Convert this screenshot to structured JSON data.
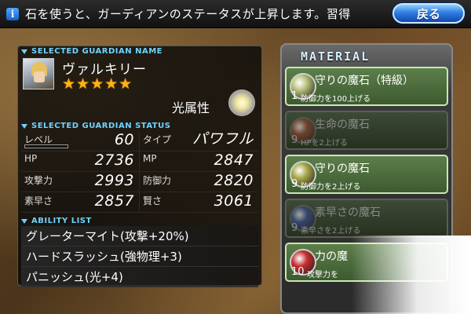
{
  "info_bar": {
    "icon": "info-icon",
    "text": "石を使うと、ガーディアンのステータスが上昇します。習得",
    "back_label": "戻る"
  },
  "guardian": {
    "name_header": "SELECTED GUARDIAN NAME",
    "name": "ヴァルキリー",
    "stars": "★★★★★",
    "rarity": 5,
    "attribute": "光属性",
    "status_header": "SELECTED GUARDIAN STATUS",
    "stats": {
      "level_label": "レベル",
      "level": "60",
      "type_label": "タイプ",
      "type": "パワフル",
      "hp_label": "HP",
      "hp": "2736",
      "mp_label": "MP",
      "mp": "2847",
      "atk_label": "攻撃力",
      "atk": "2993",
      "def_label": "防御力",
      "def": "2820",
      "spd_label": "素早さ",
      "spd": "2857",
      "int_label": "賢さ",
      "int": "3061"
    },
    "ability_header": "ABILITY LIST",
    "abilities": [
      "グレーターマイト(攻撃+20%)",
      "ハードスラッシュ(強物理+3)",
      "パニッシュ(光+4)"
    ]
  },
  "material": {
    "title": "MATERIAL",
    "items": [
      {
        "name": "守りの魔石（特級）",
        "count": "1",
        "desc": "防御力を100上げる",
        "enabled": true,
        "color": "#b9c07a"
      },
      {
        "name": "生命の魔石",
        "count": "9",
        "desc": "HPを2上げる",
        "enabled": false,
        "color": "#a04530"
      },
      {
        "name": "守りの魔石",
        "count": "9",
        "desc": "防御力を2上げる",
        "enabled": true,
        "color": "#a8a84a"
      },
      {
        "name": "素早さの魔石",
        "count": "9",
        "desc": "素早さを2上げる",
        "enabled": false,
        "color": "#3a4ea0"
      },
      {
        "name": "力の魔",
        "count": "10",
        "desc": "攻撃力を",
        "enabled": true,
        "color": "#c83030"
      }
    ]
  },
  "colors": {
    "section_header": "#6fd3ff",
    "star": "#ffb21c",
    "back_button": "#2f7fe0",
    "material_active": "#5c7e4a"
  }
}
